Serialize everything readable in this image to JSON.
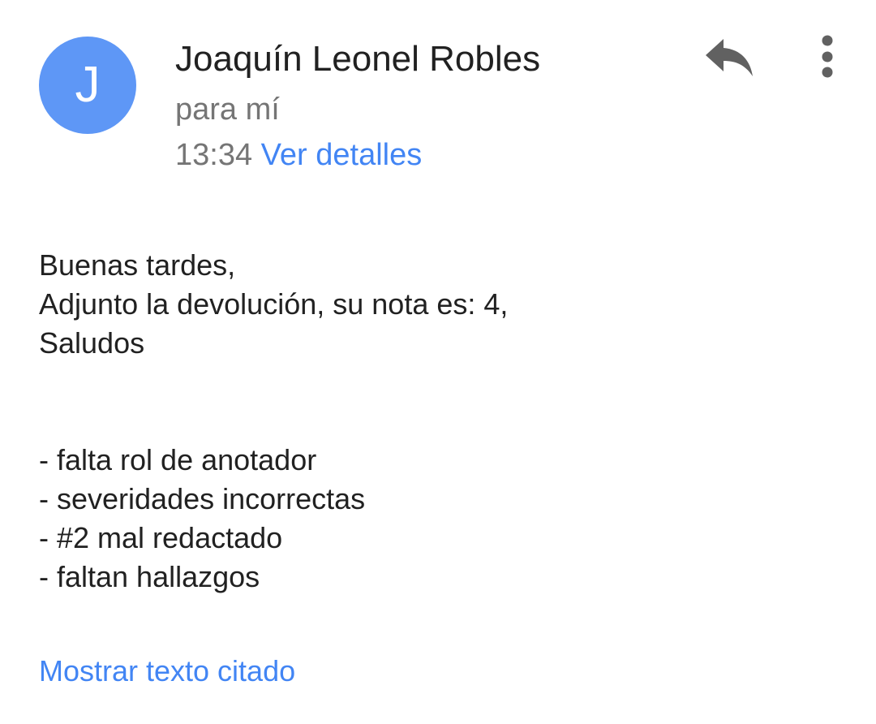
{
  "email": {
    "avatar_initial": "J",
    "sender_name": "Joaquín Leonel Robles",
    "recipient": "para mí",
    "time": "13:34",
    "details_link": "Ver detalles",
    "body_lines": [
      "Buenas tardes,",
      "Adjunto la devolución, su nota es: 4,",
      "Saludos"
    ],
    "notes": [
      "- falta rol de anotador",
      "- severidades incorrectas",
      "- #2 mal redactado",
      "- faltan hallazgos"
    ],
    "quoted_link": "Mostrar texto citado"
  },
  "icons": {
    "reply": "reply-icon",
    "more": "more-vert-icon"
  },
  "colors": {
    "avatar": "#5e97f6",
    "link": "#4285f4",
    "secondary_text": "#757575",
    "icon": "#616161"
  }
}
